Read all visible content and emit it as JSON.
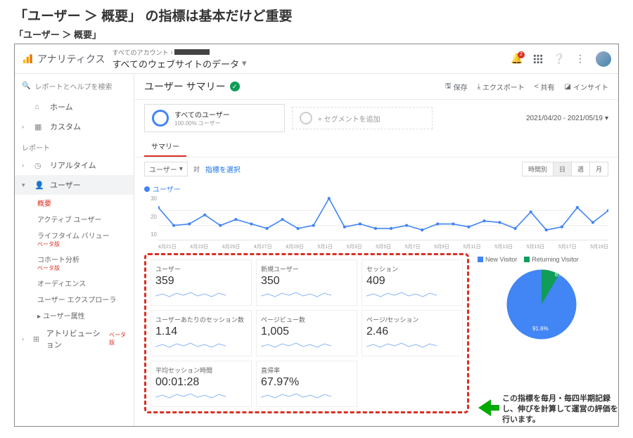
{
  "slide": {
    "title": "「ユーザー ＞ 概要」 の指標は基本だけど重要",
    "subtitle": "「ユーザー ＞ 概要」"
  },
  "app": {
    "name": "アナリティクス"
  },
  "breadcrumb": {
    "parent": "すべてのアカウント",
    "page": "すべてのウェブサイトのデータ"
  },
  "search": {
    "placeholder": "レポートとヘルプを検索"
  },
  "nav": {
    "home": "ホーム",
    "custom": "カスタム",
    "reports_hdr": "レポート",
    "realtime": "リアルタイム",
    "user": "ユーザー",
    "subs": [
      "概要",
      "アクティブ ユーザー"
    ],
    "lifetime": "ライフタイム バリュー",
    "cohort": "コホート分析",
    "audience": "オーディエンス",
    "explorer": "ユーザー エクスプローラ",
    "attrs": "ユーザー属性",
    "attribution": "アトリビューション",
    "beta": "ベータ版"
  },
  "page": {
    "title": "ユーザー サマリー",
    "save": "保存",
    "export": "エクスポート",
    "share": "共有",
    "insight": "インサイト",
    "seg_all": "すべてのユーザー",
    "seg_all_pct": "100.00% ユーザー",
    "seg_add": "+ セグメントを追加",
    "date": "2021/04/20 - 2021/05/19",
    "tab": "サマリー",
    "metric_sel": "ユーザー",
    "vs": "対",
    "metric_link": "指標を選択",
    "period": "時間別",
    "day": "日",
    "week": "週",
    "month": "月",
    "series": "ユーザー"
  },
  "chart_data": {
    "type": "line",
    "ylabel": "",
    "ylim": [
      0,
      30
    ],
    "yticks": [
      10,
      20,
      30
    ],
    "categories": [
      "4月21日",
      "4月23日",
      "4月25日",
      "4月27日",
      "4月29日",
      "5月1日",
      "5月3日",
      "5月5日",
      "5月7日",
      "5月9日",
      "5月11日",
      "5月13日",
      "5月15日",
      "5月17日",
      "5月19日"
    ],
    "values": [
      22,
      10,
      11,
      17,
      10,
      14,
      11,
      8,
      14,
      8,
      10,
      28,
      9,
      11,
      8,
      8,
      10,
      7,
      11,
      11,
      9,
      13,
      12,
      8,
      19,
      7,
      9,
      22,
      12,
      20
    ]
  },
  "metrics": [
    {
      "label": "ユーザー",
      "value": "359"
    },
    {
      "label": "新規ユーザー",
      "value": "350"
    },
    {
      "label": "セッション",
      "value": "409"
    },
    {
      "label": "ユーザーあたりのセッション数",
      "value": "1.14"
    },
    {
      "label": "ページビュー数",
      "value": "1,005"
    },
    {
      "label": "ページ/セッション",
      "value": "2.46"
    },
    {
      "label": "平均セッション時間",
      "value": "00:01:28"
    },
    {
      "label": "直帰率",
      "value": "67.97%"
    }
  ],
  "pie": {
    "legend": [
      {
        "label": "New Visitor",
        "color": "#4285f4"
      },
      {
        "label": "Returning Visitor",
        "color": "#0f9d58"
      }
    ],
    "slices": [
      {
        "pct": "91.6%",
        "val": 91.6
      },
      {
        "pct": "8.4%",
        "val": 8.4
      }
    ]
  },
  "annotation": "この指標を毎月・毎四半期記録し、伸びを計算して運営の評価を行います。",
  "notif_count": "2"
}
